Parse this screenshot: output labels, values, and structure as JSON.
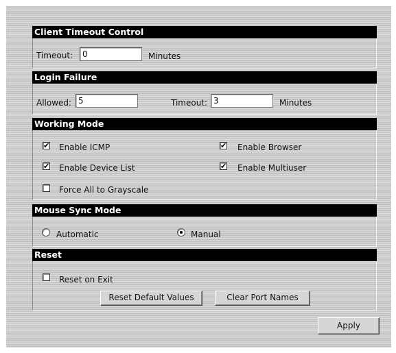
{
  "client_timeout": {
    "title": "Client Timeout Control",
    "timeout_label": "Timeout:",
    "timeout_value": "0",
    "units": "Minutes"
  },
  "login_failure": {
    "title": "Login Failure",
    "allowed_label": "Allowed:",
    "allowed_value": "5",
    "timeout_label": "Timeout:",
    "timeout_value": "3",
    "units": "Minutes"
  },
  "working_mode": {
    "title": "Working Mode",
    "options": [
      {
        "label": "Enable ICMP",
        "checked": true
      },
      {
        "label": "Enable Browser",
        "checked": true
      },
      {
        "label": "Enable Device List",
        "checked": true
      },
      {
        "label": "Enable Multiuser",
        "checked": true
      },
      {
        "label": "Force All to Grayscale",
        "checked": false
      }
    ]
  },
  "mouse_sync": {
    "title": "Mouse Sync Mode",
    "options": [
      {
        "label": "Automatic",
        "selected": false
      },
      {
        "label": "Manual",
        "selected": true
      }
    ]
  },
  "reset": {
    "title": "Reset",
    "reset_on_exit_label": "Reset on Exit",
    "reset_on_exit_checked": false,
    "reset_defaults_button": "Reset Default Values",
    "clear_port_names_button": "Clear Port Names"
  },
  "footer": {
    "apply_button": "Apply"
  }
}
